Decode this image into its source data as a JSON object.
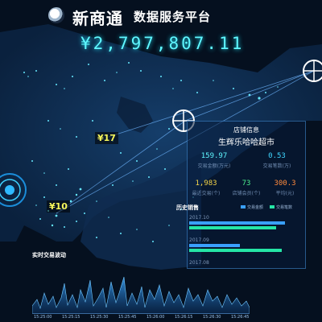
{
  "header": {
    "brand": "新商通",
    "subtitle": "数据服务平台",
    "total": "¥2,797,807.11"
  },
  "markers": [
    {
      "label": "¥17"
    },
    {
      "label": "¥10"
    }
  ],
  "store_panel": {
    "title": "店铺信息",
    "name": "生辉乐哈哈超市",
    "stats": [
      {
        "value": "159.97",
        "label": "交易金额(万元)",
        "color": "#5ff7ff"
      },
      {
        "value": "0.53",
        "label": "交易笔数(万)",
        "color": "#3fd6ff"
      },
      {
        "value": "1,983",
        "label": "最近交易(个)",
        "color": "#f5d64a"
      },
      {
        "value": "73",
        "label": "店铺会员(个)",
        "color": "#4cf08f"
      },
      {
        "value": "300.3",
        "label": "平均(元)",
        "color": "#ff8a3c"
      }
    ],
    "history": {
      "title": "历史销售",
      "legend": [
        "交易金额",
        "交易笔数"
      ],
      "years": [
        {
          "year": "2017.10",
          "amount": 0.85,
          "count": 0.77
        },
        {
          "year": "2017.09",
          "amount": 0.45,
          "count": 0.82
        },
        {
          "year": "2017.08",
          "amount": 0.0,
          "count": 0.0
        }
      ]
    }
  },
  "wave": {
    "title": "实时交易波动",
    "ticks": [
      "15:25:00",
      "15:25:15",
      "15:25:30",
      "15:25:45",
      "15:26:00",
      "15:26:15",
      "15:26:30",
      "15:26:45"
    ]
  },
  "colors": {
    "accent": "#5ff7ff",
    "amount_bar": "#3aa0ff",
    "count_bar": "#25e6a6"
  }
}
